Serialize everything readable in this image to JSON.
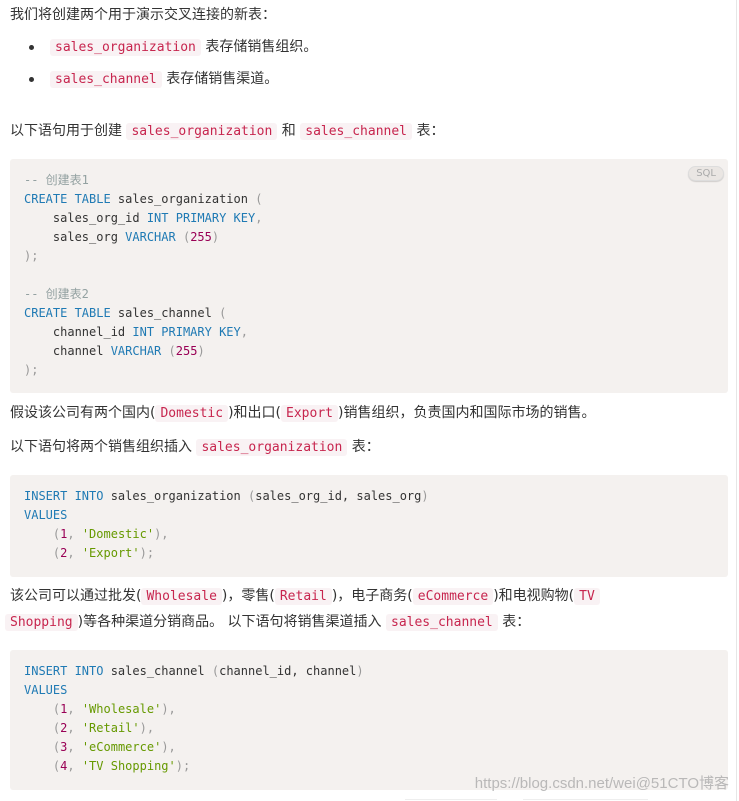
{
  "intro": "我们将创建两个用于演示交叉连接的新表：",
  "bullets": [
    {
      "code": "sales_organization",
      "text": " 表存储销售组织。"
    },
    {
      "code": "sales_channel",
      "text": " 表存储销售渠道。"
    }
  ],
  "create_para": {
    "prefix": "以下语句用于创建 ",
    "code1": "sales_organization",
    "middle": " 和 ",
    "code2": "sales_channel",
    "suffix": " 表："
  },
  "code_block_1": {
    "lang": "SQL",
    "comment1": "-- 创建表1",
    "create_kw": "CREATE TABLE",
    "table1": " sales_organization ",
    "col1": "    sales_org_id ",
    "col1_type": "INT PRIMARY KEY",
    "col2": "    sales_org ",
    "varchar": "VARCHAR",
    "len": "255",
    "comment2": "-- 创建表2",
    "table2": " sales_channel ",
    "col3": "    channel_id ",
    "col4": "    channel "
  },
  "org_para": {
    "p1": "假设该公司有两个国内(",
    "code1": "Domestic",
    "p2": ")和出口(",
    "code2": "Export",
    "p3": ")销售组织，负责国内和国际市场的销售。"
  },
  "insert_org_para": {
    "prefix": "以下语句将两个销售组织插入 ",
    "code": "sales_organization",
    "suffix": " 表："
  },
  "code_block_2": {
    "insert_kw": "INSERT INTO",
    "table": " sales_organization ",
    "cols": "sales_org_id, sales_org",
    "values_kw": "VALUES",
    "rows": [
      {
        "n": "1",
        "s": "'Domestic'",
        "end": "),"
      },
      {
        "n": "2",
        "s": "'Export'",
        "end": ");"
      }
    ]
  },
  "channel_para": {
    "p1": "该公司可以通过批发(",
    "c1": "Wholesale",
    "p2": ")，零售(",
    "c2": "Retail",
    "p3": ")，电子商务(",
    "c3": "eCommerce",
    "p4": ")和电视购物(",
    "c4a": "TV",
    "c4b": "Shopping",
    "p5": ")等各种渠道分销商品。 以下语句将销售渠道插入 ",
    "c5": "sales_channel",
    "p6": " 表："
  },
  "code_block_3": {
    "insert_kw": "INSERT INTO",
    "table": " sales_channel ",
    "cols": "channel_id, channel",
    "values_kw": "VALUES",
    "rows": [
      {
        "n": "1",
        "s": "'Wholesale'",
        "end": "),"
      },
      {
        "n": "2",
        "s": "'Retail'",
        "end": "),"
      },
      {
        "n": "3",
        "s": "'eCommerce'",
        "end": "),"
      },
      {
        "n": "4",
        "s": "'TV Shopping'",
        "end": ");"
      }
    ]
  },
  "watermark": "https://blog.csdn.net/wei@51CTO博客"
}
